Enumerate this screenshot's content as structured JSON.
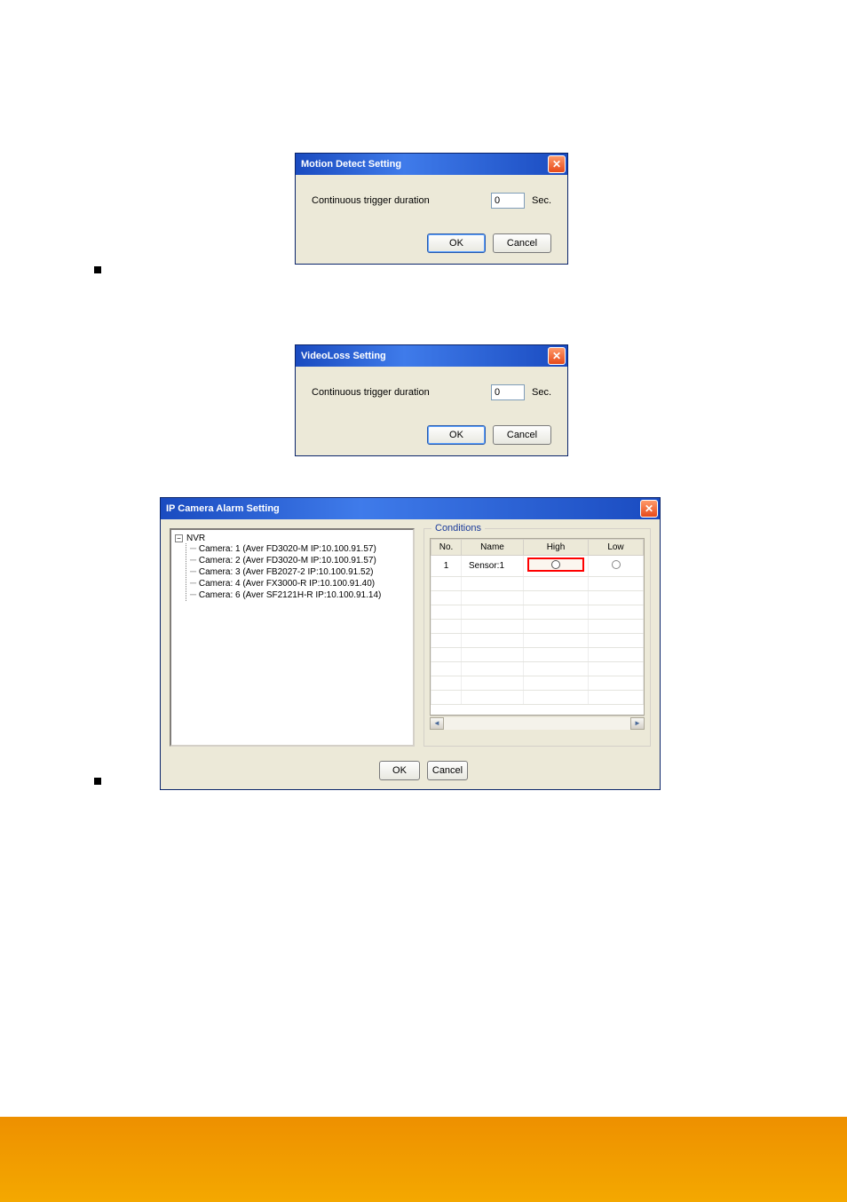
{
  "dialog1": {
    "title": "Motion Detect Setting",
    "label": "Continuous trigger duration",
    "value": "0",
    "unit": "Sec.",
    "ok": "OK",
    "cancel": "Cancel"
  },
  "dialog2": {
    "title": "VideoLoss Setting",
    "label": "Continuous trigger duration",
    "value": "0",
    "unit": "Sec.",
    "ok": "OK",
    "cancel": "Cancel"
  },
  "dialog3": {
    "title": "IP Camera Alarm Setting",
    "tree_root": "NVR",
    "tree_items": [
      "Camera: 1 (Aver FD3020-M IP:10.100.91.57)",
      "Camera: 2 (Aver FD3020-M IP:10.100.91.57)",
      "Camera: 3 (Aver FB2027-2 IP:10.100.91.52)",
      "Camera: 4 (Aver FX3000-R IP:10.100.91.40)",
      "Camera: 6 (Aver SF2121H-R IP:10.100.91.14)"
    ],
    "conditions_legend": "Conditions",
    "headers": {
      "no": "No.",
      "name": "Name",
      "high": "High",
      "low": "Low"
    },
    "rows": [
      {
        "no": "1",
        "name": "Sensor:1",
        "high": "O",
        "low": ""
      }
    ],
    "ok": "OK",
    "cancel": "Cancel"
  },
  "chart_data": {
    "type": "table",
    "title": "Conditions",
    "columns": [
      "No.",
      "Name",
      "High",
      "Low"
    ],
    "rows": [
      [
        "1",
        "Sensor:1",
        "O",
        ""
      ]
    ]
  }
}
